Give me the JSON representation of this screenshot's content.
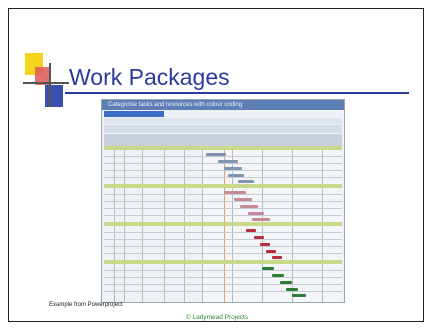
{
  "slide": {
    "title": "Work Packages",
    "caption_left": "Example from Powerproject",
    "footer": "© Ladymead Projects"
  },
  "screenshot": {
    "header_text": "Categorise tasks and resources with colour coding"
  },
  "colors": {
    "title": "#2b3a9c",
    "footer": "#2a8a2a",
    "logo_yellow": "#f5d51e",
    "logo_blue": "#3a4fb0",
    "logo_red": "#e06060"
  }
}
